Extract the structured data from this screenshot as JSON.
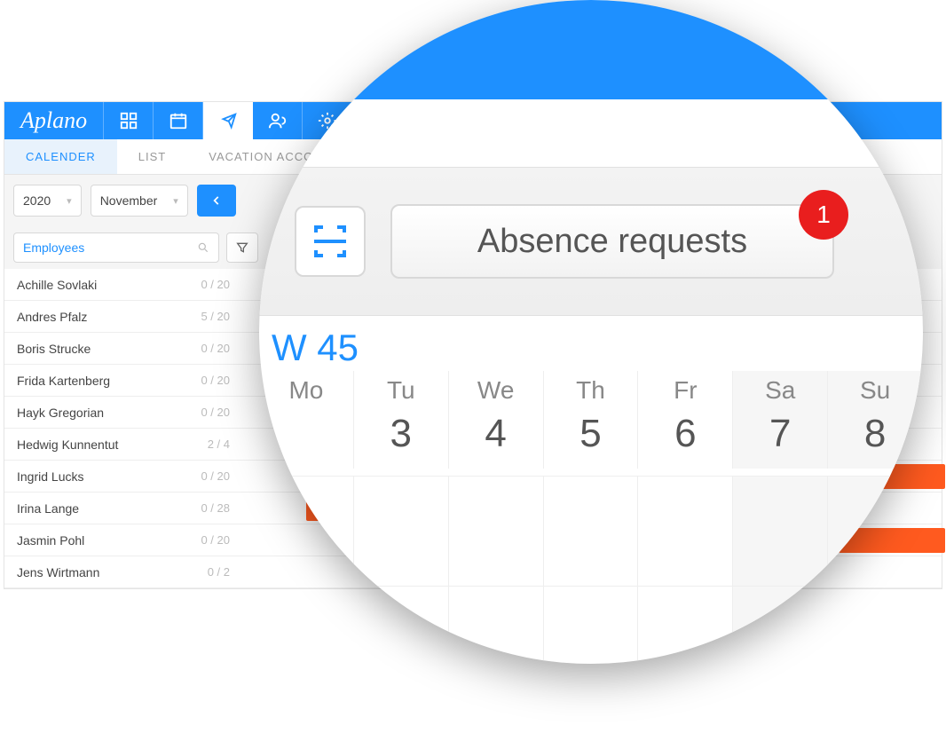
{
  "brand": "Aplano",
  "tabs": [
    "CALENDER",
    "LIST",
    "VACATION ACCOU"
  ],
  "year": "2020",
  "month": "November",
  "search_placeholder": "Employees",
  "employees": [
    {
      "name": "Achille Sovlaki",
      "stat": "0 / 20"
    },
    {
      "name": "Andres Pfalz",
      "stat": "5 / 20"
    },
    {
      "name": "Boris Strucke",
      "stat": "0 / 20"
    },
    {
      "name": "Frida Kartenberg",
      "stat": "0 / 20"
    },
    {
      "name": "Hayk Gregorian",
      "stat": "0 / 20"
    },
    {
      "name": "Hedwig Kunnentut",
      "stat": "2 / 4"
    },
    {
      "name": "Ingrid Lucks",
      "stat": "0 / 20"
    },
    {
      "name": "Irina Lange",
      "stat": "0 / 28"
    },
    {
      "name": "Jasmin Pohl",
      "stat": "0 / 20"
    },
    {
      "name": "Jens Wirtmann",
      "stat": "0 / 2"
    }
  ],
  "magnifier": {
    "absence_label": "Absence requests",
    "badge": "1",
    "week_label": "W 45",
    "days": [
      {
        "name": "Mo",
        "num": ""
      },
      {
        "name": "Tu",
        "num": "3"
      },
      {
        "name": "We",
        "num": "4"
      },
      {
        "name": "Th",
        "num": "5"
      },
      {
        "name": "Fr",
        "num": "6"
      },
      {
        "name": "Sa",
        "num": "7",
        "weekend": true
      },
      {
        "name": "Su",
        "num": "8",
        "weekend": true
      }
    ]
  }
}
